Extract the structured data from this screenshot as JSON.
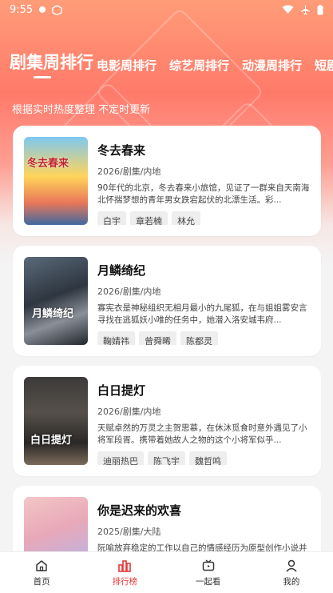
{
  "status_bar": {
    "time": "9:55"
  },
  "tabs": [
    {
      "label": "剧集周排行",
      "active": true
    },
    {
      "label": "电影周排行"
    },
    {
      "label": "综艺周排行"
    },
    {
      "label": "动漫周排行"
    },
    {
      "label": "短剧"
    }
  ],
  "subtitle": "根据实时热度整理 不定时更新",
  "items": [
    {
      "title": "冬去春来",
      "meta": "2026/剧集/内地",
      "desc": "90年代的北京，冬去春来小旅馆，见证了一群来自天南海北怀揣梦想的青年男女跌宕起伏的北漂生活。彩...",
      "cast": [
        "白宇",
        "章若楠",
        "林允"
      ],
      "poster_text": "冬去春来"
    },
    {
      "title": "月鳞绮纪",
      "meta": "2026/剧集/内地",
      "desc": "寡宪衣是神秘组织无相月最小的九尾狐，在与姐姐雾安言寻找在逃狐妖小唯的任务中，她潜入洛安城韦府...",
      "cast": [
        "鞠婧祎",
        "曾舜晞",
        "陈都灵"
      ],
      "poster_text": "月鳞绮纪"
    },
    {
      "title": "白日提灯",
      "meta": "2026/剧集/内地",
      "desc": "天赋卓然的万灵之主贺思慕，在休沐觅食时意外遇见了小将军段胥。携带着她故人之物的这个小将军似乎...",
      "cast": [
        "迪丽热巴",
        "陈飞宇",
        "魏哲鸣"
      ],
      "poster_text": "白日提灯"
    },
    {
      "title": "你是迟来的欢喜",
      "meta": "2025/剧集/大陆",
      "desc": "阮喻放弃稳定的工作以自己的情感经历为原型创作小说并发布在网上，但没想到被网友指出有抄袭嫌疑...",
      "cast": [],
      "poster_text": ""
    }
  ],
  "bottom_nav": [
    {
      "label": "首页",
      "icon": "home-icon"
    },
    {
      "label": "排行榜",
      "icon": "ranking-icon",
      "active": true
    },
    {
      "label": "一起看",
      "icon": "watch-together-icon"
    },
    {
      "label": "我的",
      "icon": "profile-icon"
    }
  ],
  "colors": {
    "accent": "#e8383a",
    "header_top": "#ff9c78",
    "header_mid": "#ff7a6a"
  }
}
